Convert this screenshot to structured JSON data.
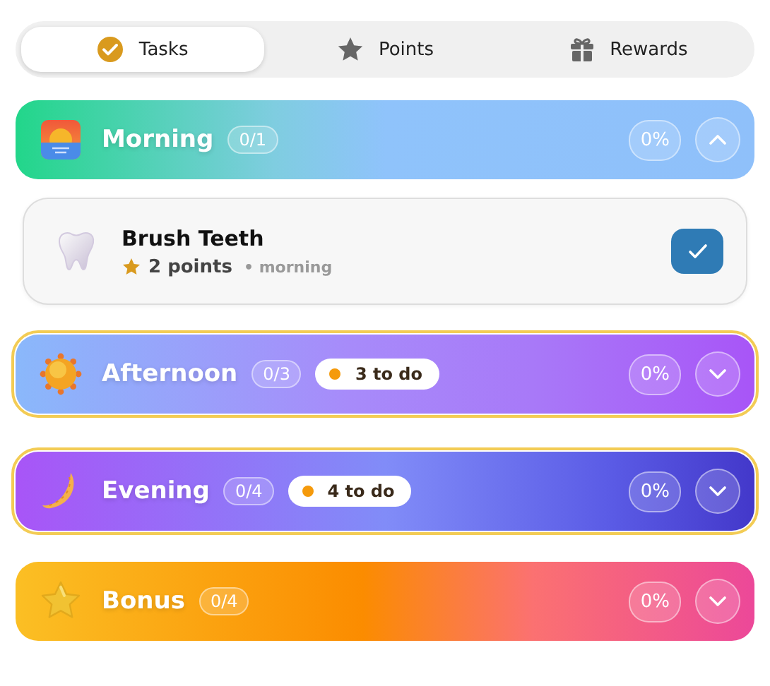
{
  "tabs": [
    {
      "label": "Tasks",
      "kind": "check",
      "selected": true
    },
    {
      "label": "Points",
      "kind": "star",
      "selected": false
    },
    {
      "label": "Rewards",
      "kind": "gift",
      "selected": false
    }
  ],
  "sections": [
    {
      "kind": "morning",
      "title": "Morning",
      "count": "0/1",
      "percent": "0%",
      "expanded": true,
      "highlighted": false,
      "tasks": [
        {
          "title": "Brush Teeth",
          "points": "2 points",
          "period": "• morning",
          "checked": true
        }
      ]
    },
    {
      "kind": "afternoon",
      "title": "Afternoon",
      "count": "0/3",
      "todo": "3 to do",
      "percent": "0%",
      "expanded": false,
      "highlighted": true
    },
    {
      "kind": "evening",
      "title": "Evening",
      "count": "0/4",
      "todo": "4 to do",
      "percent": "0%",
      "expanded": false,
      "highlighted": true
    },
    {
      "kind": "bonus",
      "title": "Bonus",
      "count": "0/4",
      "percent": "0%",
      "expanded": false,
      "highlighted": false
    }
  ]
}
